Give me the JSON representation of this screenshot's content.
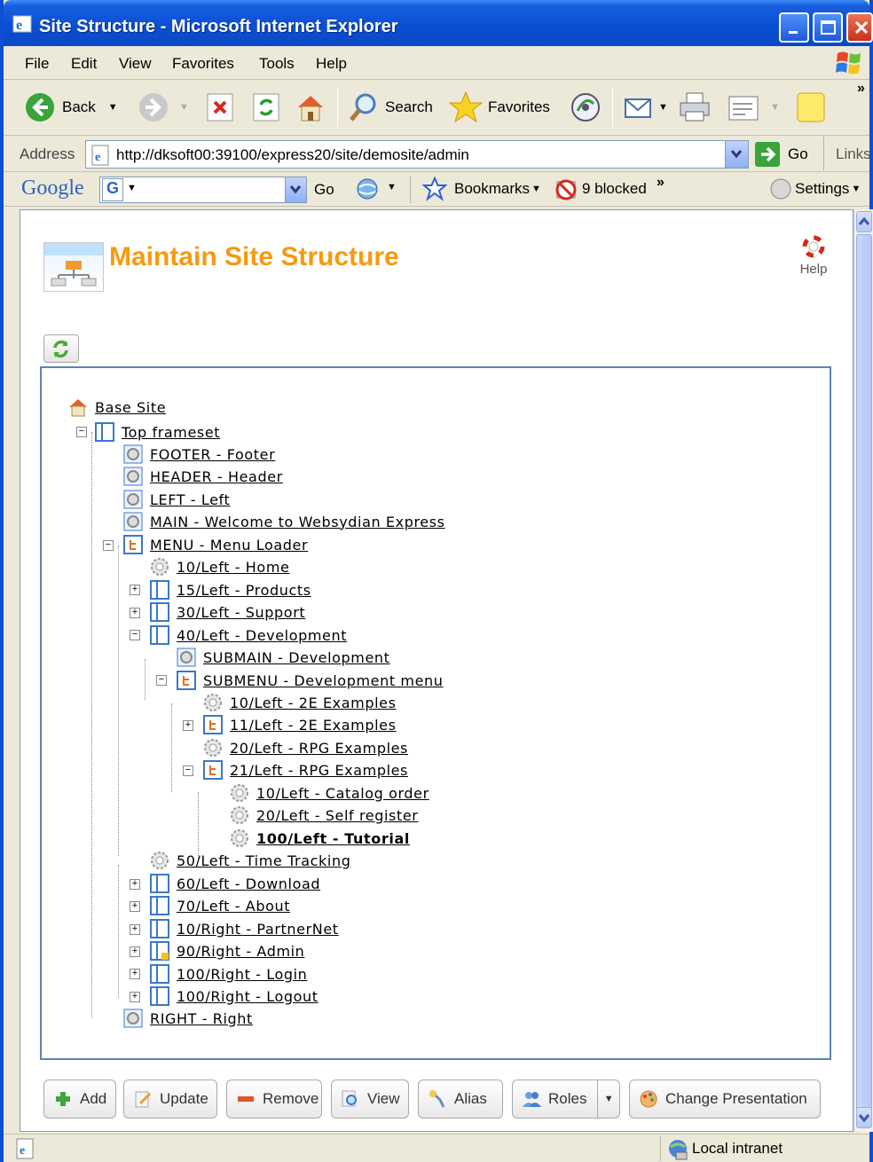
{
  "window": {
    "title": "Site Structure - Microsoft Internet Explorer"
  },
  "menu": [
    "File",
    "Edit",
    "View",
    "Favorites",
    "Tools",
    "Help"
  ],
  "toolbar": {
    "back_label": "Back",
    "search_label": "Search",
    "favorites_label": "Favorites"
  },
  "address": {
    "label": "Address",
    "url": "http://dksoft00:39100/express20/site/demosite/admin",
    "go_label": "Go",
    "links_label": "Links"
  },
  "googlebar": {
    "logo": "Google",
    "go_label": "Go",
    "bookmarks_label": "Bookmarks",
    "blocked_label": "9 blocked",
    "settings_label": "Settings"
  },
  "page": {
    "heading": "Maintain Site Structure",
    "help_label": "Help"
  },
  "tree": [
    {
      "label": "Base Site",
      "icon": "home-icon"
    },
    {
      "label": "Top frameset",
      "icon": "frameset-icon"
    },
    {
      "label": "FOOTER - Footer",
      "icon": "gear-page-icon"
    },
    {
      "label": "HEADER - Header",
      "icon": "gear-page-icon"
    },
    {
      "label": "LEFT - Left",
      "icon": "gear-page-icon"
    },
    {
      "label": "MAIN - Welcome to Websydian Express",
      "icon": "gear-page-icon"
    },
    {
      "label": "MENU - Menu Loader",
      "icon": "menu-loader-icon"
    },
    {
      "label": "10/Left - Home",
      "icon": "gear-icon"
    },
    {
      "label": "15/Left - Products",
      "icon": "frameset-icon"
    },
    {
      "label": "30/Left - Support",
      "icon": "frameset-icon"
    },
    {
      "label": "40/Left - Development",
      "icon": "frameset-icon"
    },
    {
      "label": "SUBMAIN - Development",
      "icon": "gear-page-icon"
    },
    {
      "label": "SUBMENU - Development menu",
      "icon": "menu-loader-icon"
    },
    {
      "label": "10/Left - 2E Examples",
      "icon": "gear-icon"
    },
    {
      "label": "11/Left - 2E Examples",
      "icon": "menu-loader-icon"
    },
    {
      "label": "20/Left - RPG Examples",
      "icon": "gear-icon"
    },
    {
      "label": "21/Left - RPG Examples",
      "icon": "menu-loader-icon"
    },
    {
      "label": "10/Left - Catalog order",
      "icon": "gear-icon"
    },
    {
      "label": "20/Left - Self register",
      "icon": "gear-icon"
    },
    {
      "label": "100/Left - Tutorial",
      "icon": "gear-icon",
      "selected": true
    },
    {
      "label": "50/Left - Time Tracking",
      "icon": "gear-icon"
    },
    {
      "label": "60/Left - Download",
      "icon": "frameset-icon"
    },
    {
      "label": "70/Left - About",
      "icon": "frameset-icon"
    },
    {
      "label": "10/Right - PartnerNet",
      "icon": "frameset-icon"
    },
    {
      "label": "90/Right - Admin",
      "icon": "frameset-locked-icon"
    },
    {
      "label": "100/Right - Login",
      "icon": "frameset-icon"
    },
    {
      "label": "100/Right - Logout",
      "icon": "frameset-icon"
    },
    {
      "label": "RIGHT - Right",
      "icon": "gear-page-icon"
    }
  ],
  "actions": [
    "Add",
    "Update",
    "Remove",
    "View",
    "Alias",
    "Roles",
    "Change Presentation"
  ],
  "status": {
    "zone": "Local intranet"
  }
}
